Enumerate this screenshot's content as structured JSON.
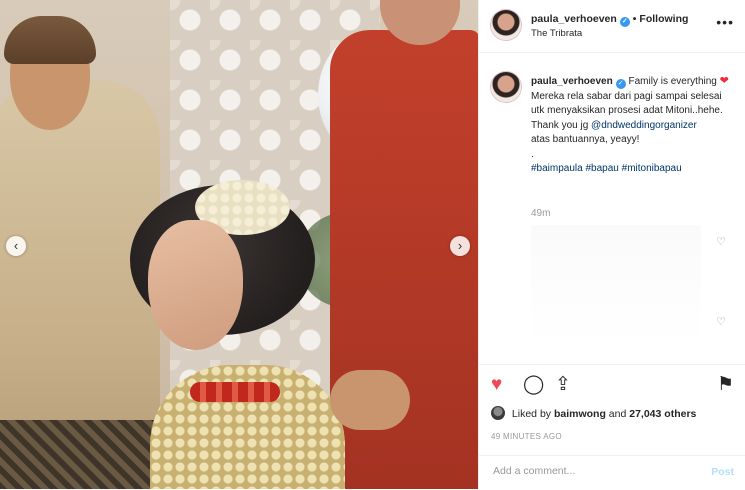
{
  "post": {
    "photo_alt": "",
    "nav": {
      "prev_icon": "‹",
      "next_icon": "›"
    }
  },
  "header": {
    "username": "paula_verhoeven",
    "verified_icon": "✓",
    "separator": "•",
    "follow_state": "Following",
    "location": "The Tribrata",
    "more_icon": "•••"
  },
  "caption": {
    "username": "paula_verhoeven",
    "text_1": "Family is everything",
    "heart_icon": "❤",
    "text_2": "Mereka rela sabar dari pagi sampai selesai utk menyaksikan prosesi adat Mitoni..hehe.",
    "text_3": "Thank you jg",
    "mention": "@dndweddingorganizer",
    "text_4": "atas bantuannya, yeayy!",
    "dot": ".",
    "hashtags": "#baimpaula #bapau #mitonibapau",
    "time": "49m"
  },
  "comment_like_icon": "♡",
  "actions": {
    "like_icon": "♥",
    "comment_icon": "◯",
    "share_icon": "⇪",
    "save_icon": "⚑"
  },
  "likes": {
    "prefix": "Liked by",
    "user": "baimwong",
    "and": "and",
    "others": "27,043 others"
  },
  "timestamp": "49 MINUTES AGO",
  "comment": {
    "placeholder": "Add a comment...",
    "post_label": "Post"
  },
  "colors": {
    "like": "#ed4956",
    "link": "#003569",
    "verified": "#3897f0",
    "post_disabled": "#b2dffc"
  }
}
